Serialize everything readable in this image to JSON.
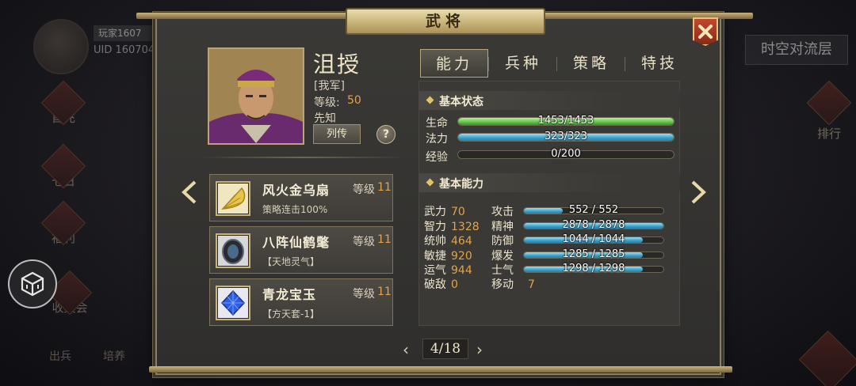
{
  "background": {
    "player_name": "玩家1607",
    "uid": "UID  160704",
    "side_menu": [
      "首充",
      "七日",
      "福利",
      "收集会"
    ],
    "bottom_menu": [
      "出兵",
      "培养",
      "",
      "",
      "",
      "",
      "",
      ""
    ],
    "right_pill": "时空对流层",
    "rank_label": "排行"
  },
  "dialog": {
    "title": "武将",
    "close_icon": "close-x-icon"
  },
  "hero": {
    "name": "沮授",
    "faction": "[我军]",
    "level_label": "等级:",
    "level": "50",
    "skill": "先知",
    "bio_button": "列传",
    "help_button": "?"
  },
  "equipment": [
    {
      "name": "风火金乌扇",
      "level_label": "等级",
      "level": "11",
      "desc": "策略连击100%",
      "icon": "golden-fan-icon"
    },
    {
      "name": "八阵仙鹤氅",
      "level_label": "等级",
      "level": "11",
      "desc": "【天地灵气】",
      "icon": "crane-cloak-icon"
    },
    {
      "name": "青龙宝玉",
      "level_label": "等级",
      "level": "11",
      "desc": "【方天套-1】",
      "icon": "blue-jade-icon"
    }
  ],
  "tabs": [
    "能力",
    "兵种",
    "策略",
    "特技"
  ],
  "active_tab": 0,
  "basic_status": {
    "title": "基本状态",
    "rows": [
      {
        "label": "生命",
        "text": "1453/1453",
        "ratio": 1.0,
        "color": "green"
      },
      {
        "label": "法力",
        "text": "323/323",
        "ratio": 1.0,
        "color": "blue"
      },
      {
        "label": "经验",
        "text": "0/200",
        "ratio": 0.0,
        "color": "blue"
      }
    ]
  },
  "basic_ability": {
    "title": "基本能力",
    "attrs": [
      {
        "label": "武力",
        "value": "70"
      },
      {
        "label": "智力",
        "value": "1328"
      },
      {
        "label": "统帅",
        "value": "464"
      },
      {
        "label": "敏捷",
        "value": "920"
      },
      {
        "label": "运气",
        "value": "944"
      },
      {
        "label": "破敌",
        "value": "0"
      }
    ],
    "combat": [
      {
        "label": "攻击",
        "text": "552 / 552",
        "ratio": 0.28
      },
      {
        "label": "精神",
        "text": "2878 / 2878",
        "ratio": 1.0
      },
      {
        "label": "防御",
        "text": "1044 / 1044",
        "ratio": 0.85
      },
      {
        "label": "爆发",
        "text": "1285 / 1285",
        "ratio": 0.85
      },
      {
        "label": "士气",
        "text": "1298 / 1298",
        "ratio": 0.85
      }
    ],
    "move_label": "移动",
    "move_value": "7"
  },
  "pagination": {
    "current": "4",
    "sep": "/",
    "total": "18",
    "text": "4/18"
  },
  "colors": {
    "accent_gold": "#c9b27a",
    "value_orange": "#e3a34a",
    "bar_green": "#5fc34a",
    "bar_blue": "#3a9ec6"
  }
}
